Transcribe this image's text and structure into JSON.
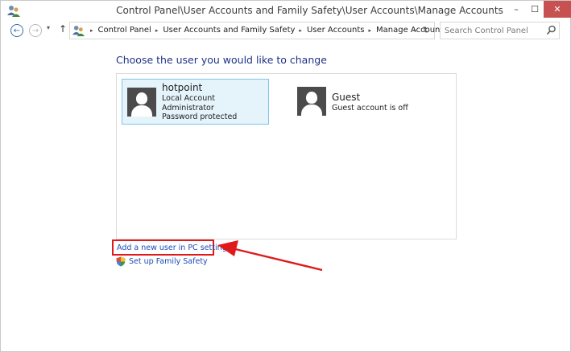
{
  "window": {
    "title": "Control Panel\\User Accounts and Family Safety\\User Accounts\\Manage Accounts",
    "minimize_glyph": "–",
    "maximize_glyph": "☐",
    "close_glyph": "✕"
  },
  "navigation": {
    "back_glyph": "←",
    "forward_glyph": "→",
    "recent_glyph": "▾",
    "up_glyph": "↑",
    "breadcrumbs": [
      "Control Panel",
      "User Accounts and Family Safety",
      "User Accounts",
      "Manage Accounts"
    ],
    "separator_glyph": "▸",
    "dropdown_glyph": "⌄",
    "refresh_glyph": "↻",
    "search_placeholder": "Search Control Panel"
  },
  "content": {
    "heading": "Choose the user you would like to change",
    "users": [
      {
        "name": "hotpoint",
        "details": [
          "Local Account",
          "Administrator",
          "Password protected"
        ],
        "selected": true
      },
      {
        "name": "Guest",
        "details": [
          "Guest account is off"
        ],
        "selected": false
      }
    ],
    "add_user_link": "Add a new user in PC settings",
    "family_safety_link": "Set up Family Safety"
  },
  "icons": {
    "app": "user-accounts-icon",
    "address": "user-accounts-icon",
    "search": "search-icon",
    "family": "shield-icon",
    "avatar": "user-silhouette-icon"
  },
  "colors": {
    "heading": "#1e3287",
    "link": "#1c4bb7",
    "selection_fill": "#e5f3fb",
    "selection_border": "#7fc4ea",
    "annotation": "#e01a1a",
    "avatar": "#4b4b4b"
  }
}
